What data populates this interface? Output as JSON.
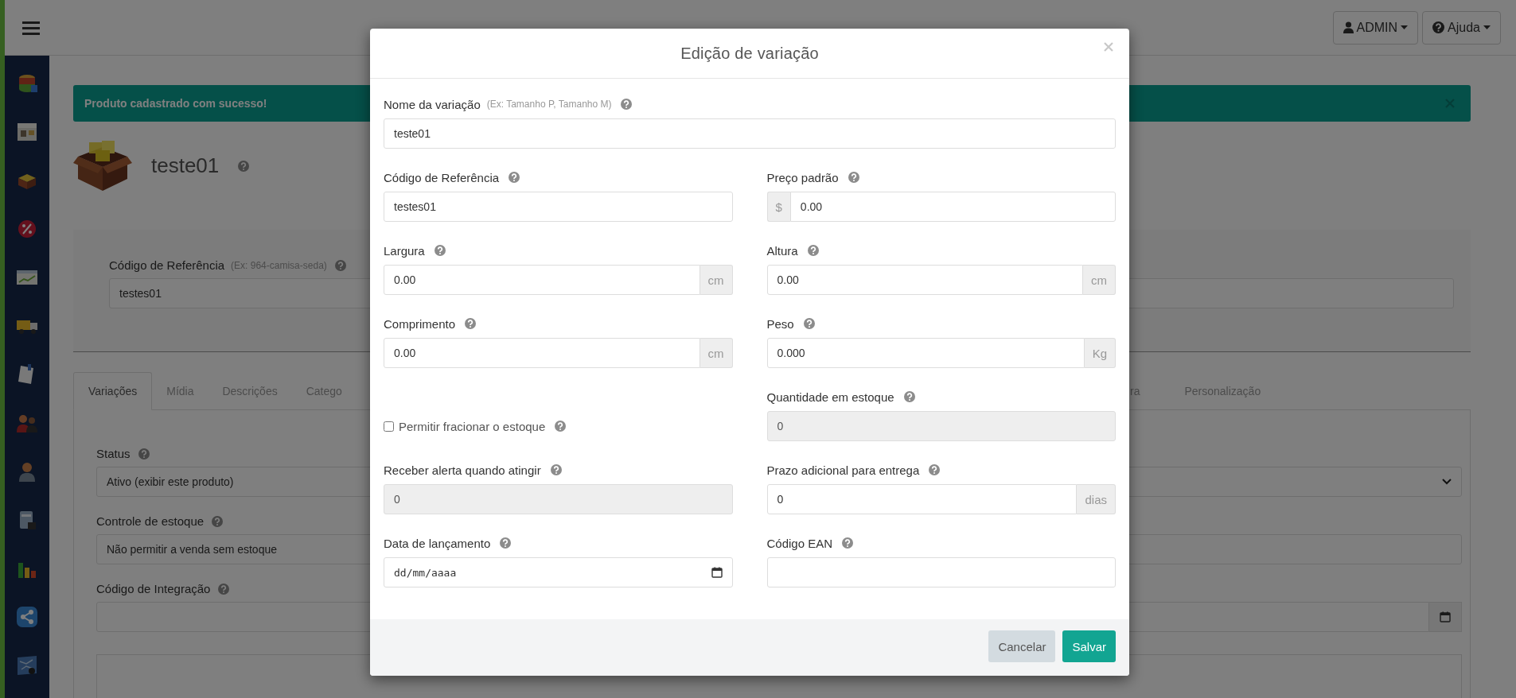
{
  "header": {
    "user_menu": "ADMIN",
    "help_menu": "Ajuda"
  },
  "alert": {
    "message": "Produto cadastrado com sucesso!"
  },
  "product": {
    "title": "teste01"
  },
  "reference_card": {
    "label": "Código de Referência",
    "hint": "(Ex: 964-camisa-seda)",
    "value": "testes01"
  },
  "tabs": [
    {
      "label": "Variações",
      "selected": true
    },
    {
      "label": "Mídia",
      "selected": false
    },
    {
      "label": "Descrições",
      "selected": false
    },
    {
      "label": "Catego",
      "selected": false
    },
    {
      "label": "ra",
      "selected": false
    },
    {
      "label": "Personalização",
      "selected": false
    }
  ],
  "variation_settings": [
    {
      "label": "Status",
      "kind": "select",
      "value": "Ativo (exibir este produto)"
    },
    {
      "label": "Controle de estoque",
      "kind": "text",
      "value": "Não permitir a venda sem estoque"
    },
    {
      "label": "Código de Integração",
      "kind": "calendar"
    }
  ],
  "modal": {
    "title": "Edição de variação",
    "fields": [
      {
        "kind": "text",
        "wide": true,
        "label": "Nome da variação",
        "hint": "(Ex: Tamanho P, Tamanho M)",
        "value": "teste01",
        "disabled": false
      },
      {
        "kind": "text",
        "label": "Código de Referência",
        "value": "testes01",
        "disabled": false
      },
      {
        "kind": "text",
        "label": "Preço padrão",
        "prefix": "$",
        "value": "0.00",
        "disabled": false
      },
      {
        "kind": "text",
        "label": "Largura",
        "value": "0.00",
        "suffix": "cm",
        "disabled": false
      },
      {
        "kind": "text",
        "label": "Altura",
        "value": "0.00",
        "suffix": "cm",
        "disabled": false
      },
      {
        "kind": "text",
        "label": "Comprimento",
        "value": "0.00",
        "suffix": "cm",
        "disabled": false
      },
      {
        "kind": "text",
        "label": "Peso",
        "value": "0.000",
        "suffix": "Kg",
        "disabled": false
      },
      {
        "kind": "checkbox",
        "label": "Permitir fracionar o estoque",
        "checked": false
      },
      {
        "kind": "text",
        "label": "Quantidade em estoque",
        "value": "0",
        "disabled": true
      },
      {
        "kind": "text",
        "label": "Receber alerta quando atingir",
        "value": "0",
        "disabled": true
      },
      {
        "kind": "text",
        "label": "Prazo adicional para entrega",
        "value": "0",
        "suffix": "dias",
        "disabled": false
      },
      {
        "kind": "date",
        "label": "Data de lançamento",
        "placeholder": "dd/mm/aaaa",
        "disabled": false
      },
      {
        "kind": "text",
        "label": "Código EAN",
        "disabled": false
      }
    ],
    "buttons": [
      {
        "label": "Cancelar",
        "kind": "secondary"
      },
      {
        "label": "Salvar",
        "kind": "primary"
      }
    ]
  }
}
